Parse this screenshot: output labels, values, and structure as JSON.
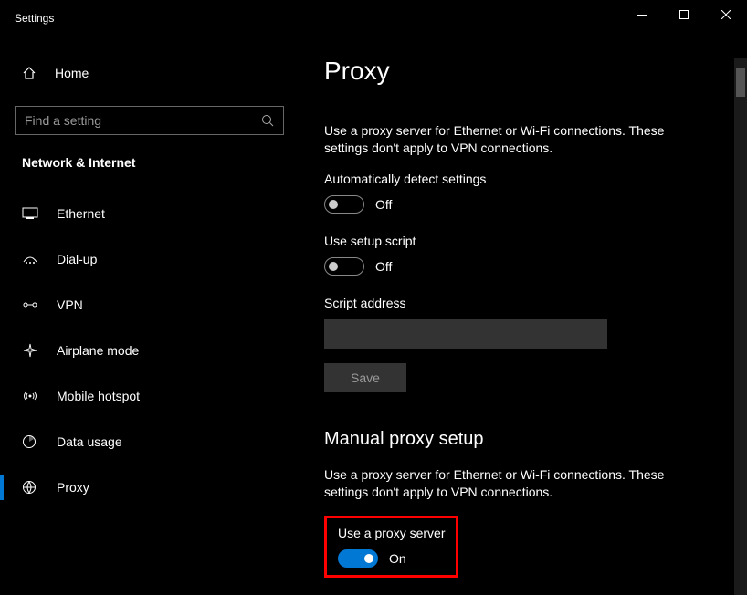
{
  "window": {
    "title": "Settings"
  },
  "sidebar": {
    "home": "Home",
    "search_placeholder": "Find a setting",
    "category": "Network & Internet",
    "items": [
      {
        "label": "Ethernet"
      },
      {
        "label": "Dial-up"
      },
      {
        "label": "VPN"
      },
      {
        "label": "Airplane mode"
      },
      {
        "label": "Mobile hotspot"
      },
      {
        "label": "Data usage"
      },
      {
        "label": "Proxy"
      }
    ]
  },
  "main": {
    "title": "Proxy",
    "desc1": "Use a proxy server for Ethernet or Wi-Fi connections. These settings don't apply to VPN connections.",
    "auto_detect_label": "Automatically detect settings",
    "auto_detect_state": "Off",
    "setup_script_label": "Use setup script",
    "setup_script_state": "Off",
    "script_address_label": "Script address",
    "save": "Save",
    "manual_title": "Manual proxy setup",
    "desc2": "Use a proxy server for Ethernet or Wi-Fi connections. These settings don't apply to VPN connections.",
    "use_proxy_label": "Use a proxy server",
    "use_proxy_state": "On"
  }
}
